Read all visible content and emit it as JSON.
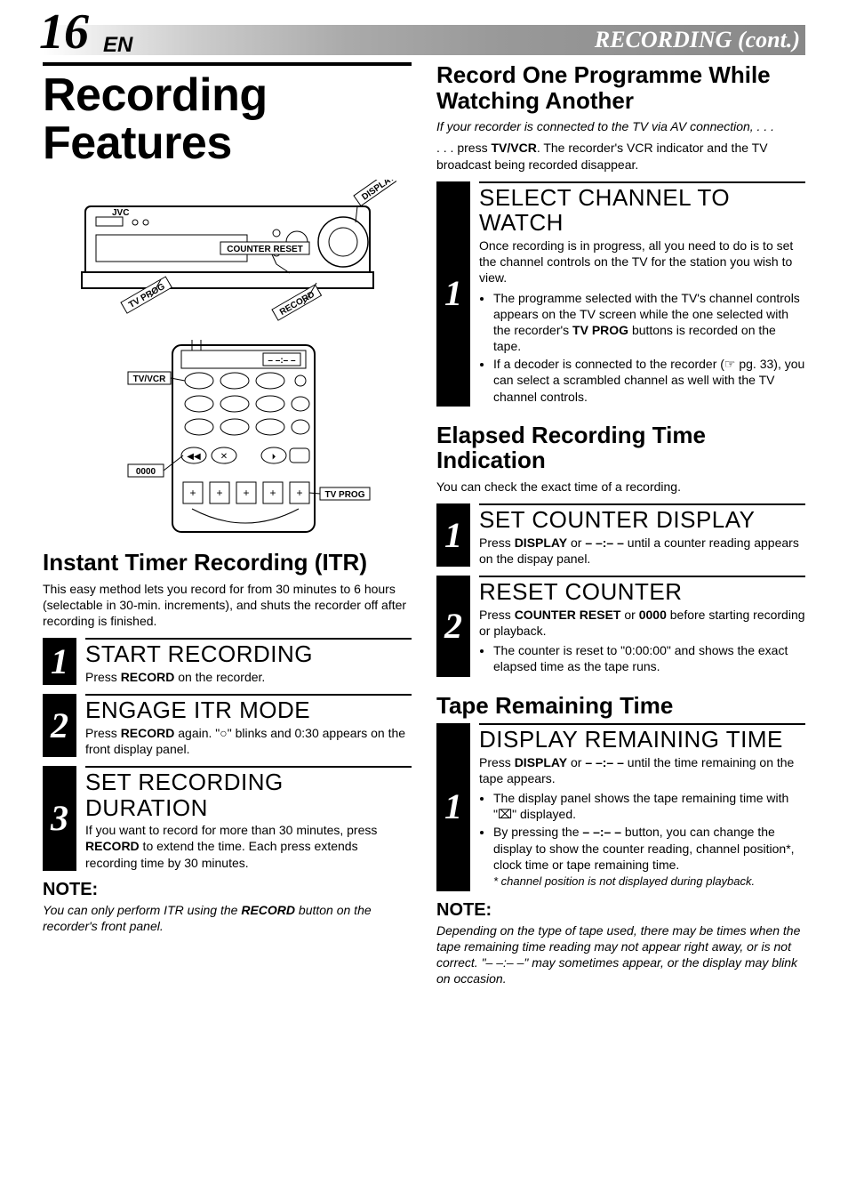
{
  "header": {
    "page_number": "16",
    "lang_suffix": "EN",
    "title": "RECORDING (cont.)"
  },
  "left": {
    "main_title": "Recording Features",
    "diagram_labels": {
      "display": "DISPLAY",
      "counter_reset": "COUNTER RESET",
      "tv_prog_top": "TV PROG",
      "record": "RECORD",
      "tv_vcr": "TV/VCR",
      "zero": "0000",
      "tv_prog_bottom": "TV PROG",
      "vcr_logo": "JVC",
      "display_clock": "– –:– –"
    },
    "itr_heading": "Instant Timer Recording (ITR)",
    "itr_intro": "This easy method lets you record for from 30 minutes to 6 hours (selectable in 30-min. increments), and shuts the recorder off after recording is finished.",
    "step1_title": "START RECORDING",
    "step1_body_a": "Press ",
    "step1_body_b": "RECORD",
    "step1_body_c": " on the recorder.",
    "step2_title": "ENGAGE ITR MODE",
    "step2_body_a": "Press ",
    "step2_body_b": "RECORD",
    "step2_body_c": " again. \"○\" blinks and 0:30 appears on the front display panel.",
    "step3_title": "SET RECORDING DURATION",
    "step3_body_a": "If you want to record for more than 30 minutes, press ",
    "step3_body_b": "RECORD",
    "step3_body_c": " to extend the time. Each press extends recording time by 30 minutes.",
    "note_head": "NOTE:",
    "note_body_a": "You can only perform ITR using the ",
    "note_body_b": "RECORD",
    "note_body_c": " button on the recorder's front panel."
  },
  "right": {
    "sec1_heading": "Record One Programme While Watching Another",
    "sec1_intro_ital": "If your recorder is connected to the TV via AV connection, . . .",
    "sec1_intro_a": ". . . press ",
    "sec1_intro_b": "TV/VCR",
    "sec1_intro_c": ". The recorder's VCR indicator and the TV broadcast being recorded disappear.",
    "sec1_step1_title": "SELECT CHANNEL TO WATCH",
    "sec1_step1_body": "Once recording is in progress, all you need to do is to set the channel controls on the TV for the station you wish to view.",
    "sec1_b1_a": "The programme selected with the TV's channel controls appears on the TV screen while the one selected with the recorder's ",
    "sec1_b1_b": "TV PROG",
    "sec1_b1_c": " buttons is recorded on the tape.",
    "sec1_b2": "If a decoder is connected to the recorder (☞ pg. 33), you can select a scrambled channel as well with the TV channel controls.",
    "sec2_heading": "Elapsed Recording Time Indication",
    "sec2_intro": "You can check the exact time of a recording.",
    "sec2_step1_title": "SET COUNTER DISPLAY",
    "sec2_step1_a": "Press ",
    "sec2_step1_b": "DISPLAY",
    "sec2_step1_c": " or ",
    "sec2_step1_d": "– –:– –",
    "sec2_step1_e": " until a counter reading appears on the dispay panel.",
    "sec2_step2_title": "RESET COUNTER",
    "sec2_step2_a": "Press ",
    "sec2_step2_b": "COUNTER RESET",
    "sec2_step2_c": " or ",
    "sec2_step2_d": "0000",
    "sec2_step2_e": " before starting recording or playback.",
    "sec2_b1": "The counter is reset to \"0:00:00\" and shows the exact elapsed time as the tape runs.",
    "sec3_heading": "Tape Remaining Time",
    "sec3_step1_title": "DISPLAY REMAINING TIME",
    "sec3_step1_a": "Press ",
    "sec3_step1_b": "DISPLAY",
    "sec3_step1_c": " or ",
    "sec3_step1_d": "– –:– –",
    "sec3_step1_e": " until the time remaining on the tape appears.",
    "sec3_b1": "The display panel shows the tape remaining time with \"⌧\" displayed.",
    "sec3_b2_a": "By pressing the ",
    "sec3_b2_b": "– –:– –",
    "sec3_b2_c": " button, you can change the display to show the counter reading, channel position*, clock time or tape remaining time.",
    "sec3_b2_foot": "* channel position is not displayed during playback.",
    "note_head": "NOTE:",
    "note_body": "Depending on the type of tape used, there may be times when the tape remaining time reading may not appear right away, or is not correct. \"– –:– –\" may sometimes appear, or the display may blink on occasion."
  }
}
